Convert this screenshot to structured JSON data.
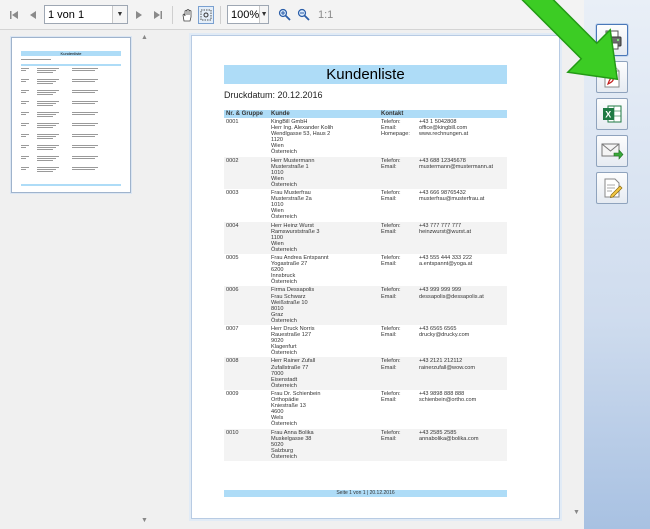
{
  "toolbar": {
    "page_value": "1 von 1",
    "zoom_value": "100%",
    "zoom_ratio_label": "1:1",
    "icons": [
      "first-page-icon",
      "prev-page-icon",
      "next-page-icon",
      "last-page-icon",
      "hand-tool-icon",
      "marquee-zoom-icon",
      "zoom-in-icon",
      "zoom-out-icon"
    ]
  },
  "document": {
    "title": "Kundenliste",
    "date_line": "Druckdatum: 20.12.2016",
    "columns": [
      "Nr. & Gruppe",
      "Kunde",
      "Kontakt"
    ],
    "rows": [
      {
        "nr": "0001",
        "kunde": [
          "KingBill GmbH",
          "Herr Ing. Alexander Kolih",
          "Wendlgasse 53, Haus 2",
          "1120",
          "Wien",
          "Österreich"
        ],
        "labels": [
          "Telefon:",
          "Email:",
          "Homepage:"
        ],
        "values": [
          "+43 1 5042808",
          "office@kingbill.com",
          "www.rechnungen.at"
        ]
      },
      {
        "nr": "0002",
        "kunde": [
          "Herr Mustermann",
          "Musterstraße 1",
          "1010",
          "Wien",
          "Österreich"
        ],
        "labels": [
          "Telefon:",
          "Email:"
        ],
        "values": [
          "+43 688 12345678",
          "mustermann@mustermann.at"
        ]
      },
      {
        "nr": "0003",
        "kunde": [
          "Frau Musterfrau",
          "Musterstraße 2a",
          "1010",
          "Wien",
          "Österreich"
        ],
        "labels": [
          "Telefon:",
          "Email:"
        ],
        "values": [
          "+43 666 98765432",
          "musterfrau@musterfrau.at"
        ]
      },
      {
        "nr": "0004",
        "kunde": [
          "Herr Heinz Wurst",
          "Ramswurststraße 3",
          "1100",
          "Wien",
          "Österreich"
        ],
        "labels": [
          "Telefon:",
          "Email:"
        ],
        "values": [
          "+43 777 777 777",
          "heinzwurst@wurst.at"
        ]
      },
      {
        "nr": "0005",
        "kunde": [
          "Frau Andrea Entspannt",
          "Yogastraße 27",
          "6200",
          "Innsbruck",
          "Österreich"
        ],
        "labels": [
          "Telefon:",
          "Email:"
        ],
        "values": [
          "+43 555 444 333 222",
          "a.entspannt@yoga.at"
        ]
      },
      {
        "nr": "0006",
        "kunde": [
          "Firma Dessapolis",
          "Frau Schwarz",
          "Weißstraße 10",
          "8010",
          "Graz",
          "Österreich"
        ],
        "labels": [
          "Telefon:",
          "Email:"
        ],
        "values": [
          "+43 999 999 999",
          "dessapolis@dessapolis.at"
        ]
      },
      {
        "nr": "0007",
        "kunde": [
          "Herr Druck Norris",
          "Rauestraße 127",
          "9020",
          "Klagenfurt",
          "Österreich"
        ],
        "labels": [
          "Telefon:",
          "Email:"
        ],
        "values": [
          "+43 6565 6565",
          "drucky@drucky.com"
        ]
      },
      {
        "nr": "0008",
        "kunde": [
          "Herr Rainer Zufall",
          "Zufallstraße 77",
          "7000",
          "Eisenstadt",
          "Österreich"
        ],
        "labels": [
          "Telefon:",
          "Email:"
        ],
        "values": [
          "+43 2121 212112",
          "rainerzufall@wow.com"
        ]
      },
      {
        "nr": "0009",
        "kunde": [
          "Frau Dr. Schienbein",
          "Orthopädie",
          "Kniestraße 13",
          "4600",
          "Wels",
          "Österreich"
        ],
        "labels": [
          "Telefon:",
          "Email:"
        ],
        "values": [
          "+43 9898 888 888",
          "schienbein@ortho.com"
        ]
      },
      {
        "nr": "0010",
        "kunde": [
          "Frau Anna Bolika",
          "Muskelgasse 38",
          "5020",
          "Salzburg",
          "Österreich"
        ],
        "labels": [
          "Telefon:",
          "Email:"
        ],
        "values": [
          "+43 2585 2585",
          "annabolika@bolika.com"
        ]
      }
    ],
    "footer": "Seite 1 von 1 | 20.12.2016"
  },
  "thumbnail": {
    "title": "Kundenliste"
  },
  "side_buttons": [
    {
      "name": "print-icon"
    },
    {
      "name": "pdf-icon"
    },
    {
      "name": "excel-icon"
    },
    {
      "name": "email-icon"
    },
    {
      "name": "edit-icon"
    }
  ],
  "colors": {
    "accent_blue": "#aedcf7",
    "arrow_green": "#3ccc24",
    "page_border": "#b8cbe3"
  }
}
